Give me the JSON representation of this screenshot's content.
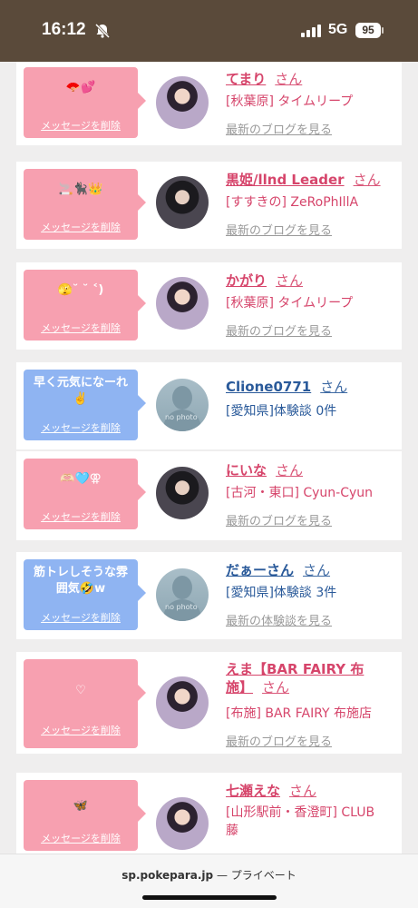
{
  "status": {
    "time": "16:12",
    "network": "5G",
    "battery": "95"
  },
  "delete_label": "メッセージを削除",
  "cards": [
    {
      "msg": "🪭💕",
      "name": "てまり",
      "san": "さん",
      "shop": "[秋葉原] タイムリープ",
      "blog": "最新のブログを見る"
    },
    {
      "msg": "🚬🐈‍⬛👑",
      "name": "黒姫/llnd Leader",
      "san": "さん",
      "shop": "[すすきの] ZeRoPhIllA",
      "blog": "最新のブログを見る"
    },
    {
      "msg": "🫣˘ ˘ ˂)",
      "name": "かがり",
      "san": "さん",
      "shop": "[秋葉原] タイムリープ",
      "blog": "最新のブログを見る"
    },
    {
      "msg": "早く元気になーれ✌️",
      "name": "Clione0771",
      "san": "さん",
      "shop": "[愛知県]体験談 0件",
      "blog": ""
    },
    {
      "msg": "🫶🏻🩵⚢",
      "name": "にいな",
      "san": "さん",
      "shop": "[古河・東口] Cyun-Cyun",
      "blog": "最新のブログを見る"
    },
    {
      "msg": "筋トレしそうな雰囲気🤣w",
      "name": "だぁーさん",
      "san": "さん",
      "shop": "[愛知県]体験談 3件",
      "blog": "最新の体験談を見る"
    },
    {
      "msg": "♡",
      "name": "えま【BAR FAIRY 布施】",
      "san": "さん",
      "shop": "[布施] BAR FAIRY 布施店",
      "blog": "最新のブログを見る"
    },
    {
      "msg": "🦋",
      "name": "七瀬えな",
      "san": "さん",
      "shop": "[山形駅前・香澄町] CLUB 藤",
      "blog": ""
    }
  ],
  "nophoto_label": "no photo",
  "url": {
    "domain": "sp.pokepara.jp",
    "sep": "—",
    "mode": "プライベート"
  },
  "colors": {
    "pink_bubble": "#f7a0b0",
    "blue_bubble": "#8fb4f2",
    "pink_text": "#d6456b",
    "blue_text": "#2a5a9a"
  }
}
